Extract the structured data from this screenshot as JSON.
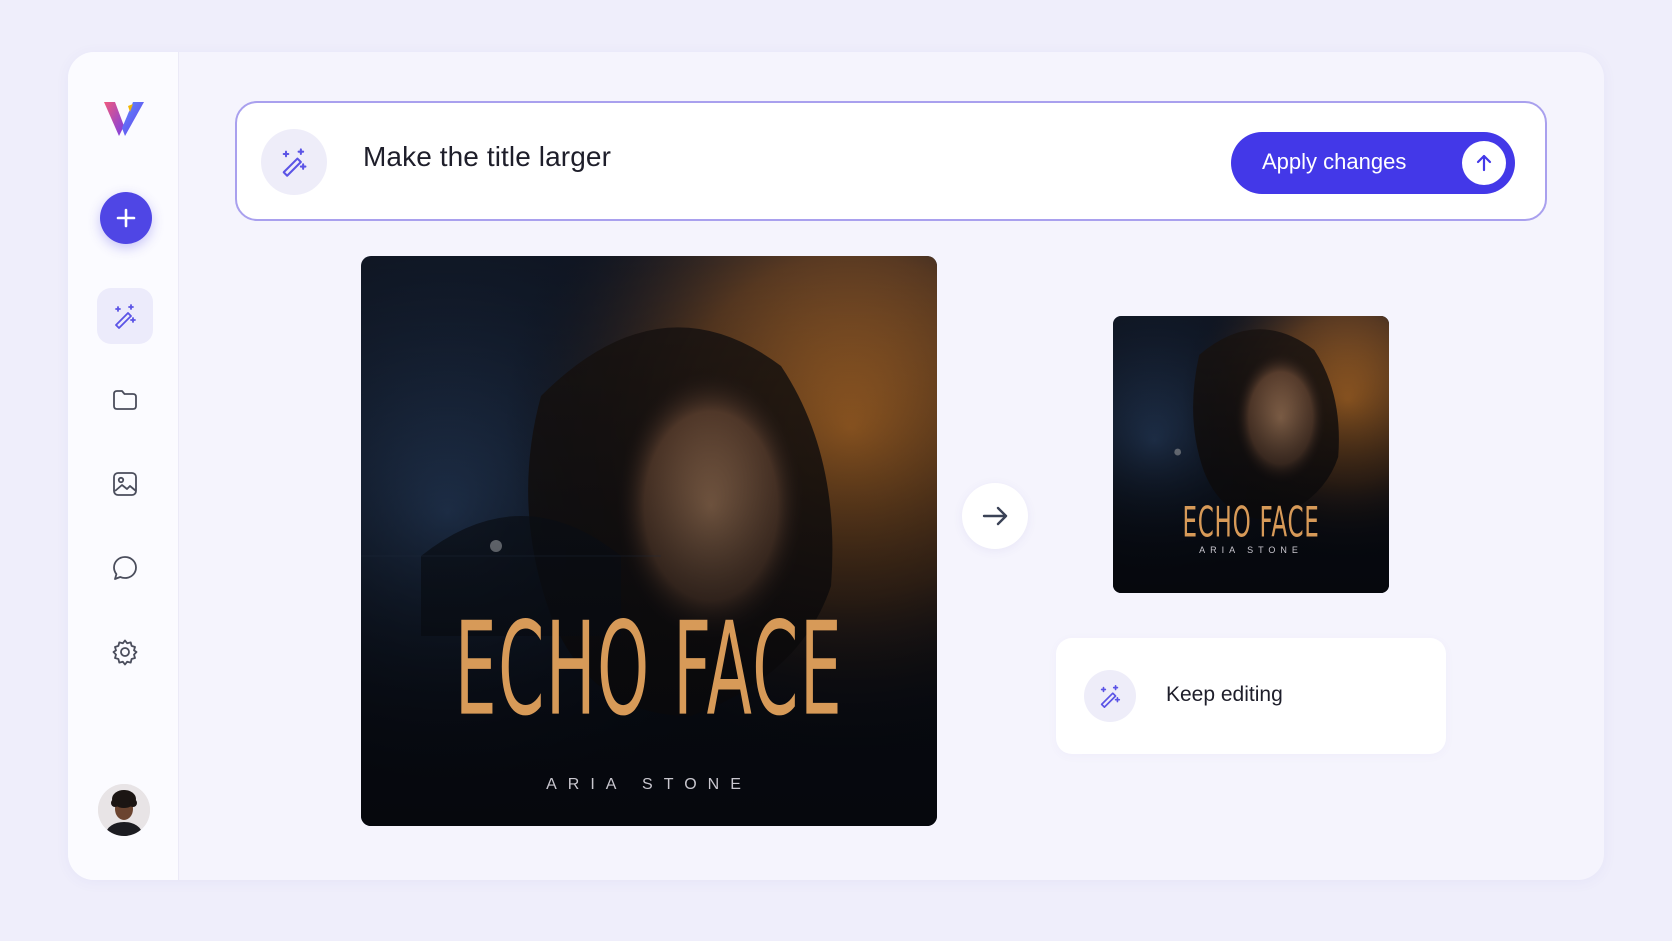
{
  "app": {
    "name": "V",
    "brand_color": "#4f46e5"
  },
  "sidebar": {
    "items": [
      {
        "id": "new",
        "icon": "plus-icon"
      },
      {
        "id": "magic-edit",
        "icon": "magic-wand-icon",
        "active": true
      },
      {
        "id": "files",
        "icon": "folder-icon"
      },
      {
        "id": "images",
        "icon": "image-icon"
      },
      {
        "id": "chat",
        "icon": "chat-bubble-icon"
      },
      {
        "id": "settings",
        "icon": "gear-icon"
      }
    ]
  },
  "prompt": {
    "text": "Make the title larger",
    "icon": "magic-wand-icon",
    "apply_label": "Apply changes"
  },
  "preview": {
    "original": {
      "title": "ECHO FACE",
      "artist": "ARIA STONE"
    },
    "edited": {
      "title": "ECHO FACE",
      "artist": "ARIA STONE"
    }
  },
  "keep_editing": {
    "label": "Keep editing",
    "icon": "magic-wand-icon"
  }
}
